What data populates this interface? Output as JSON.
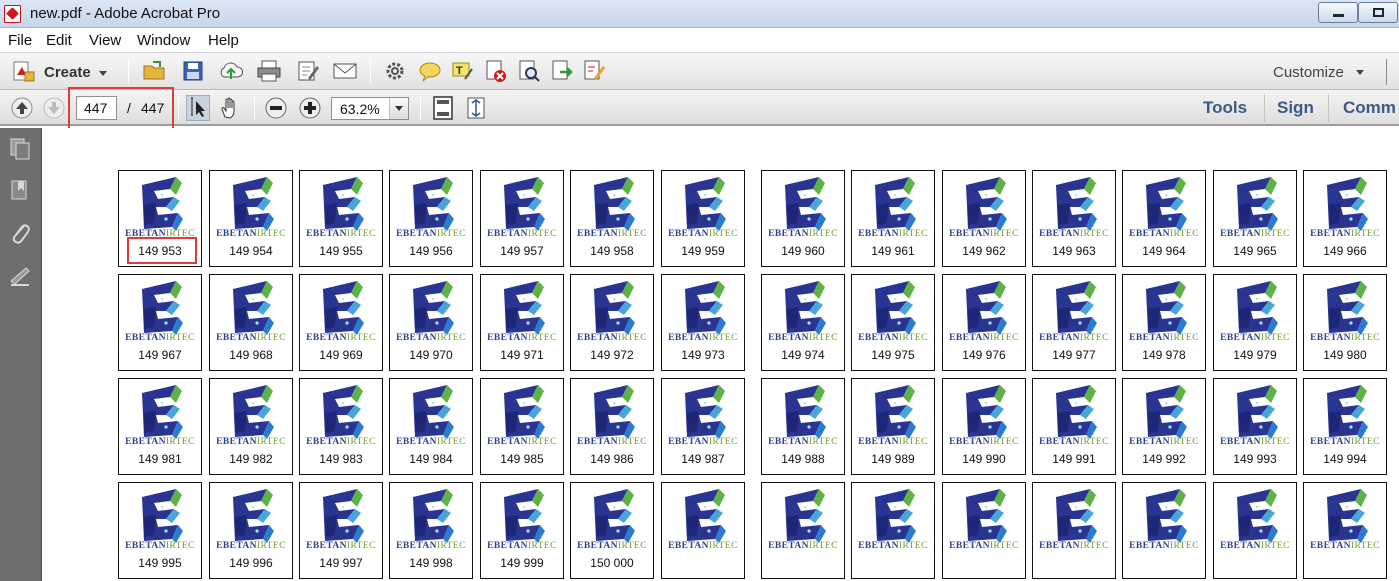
{
  "window": {
    "title": "new.pdf - Adobe Acrobat Pro"
  },
  "menu": [
    "File",
    "Edit",
    "View",
    "Window",
    "Help"
  ],
  "toolbar": {
    "create_label": "Create",
    "customize_label": "Customize"
  },
  "navigation": {
    "current_page": "447",
    "separator": "/",
    "total_pages": "447"
  },
  "zoom": {
    "value": "63.2%"
  },
  "right_links": {
    "tools": "Tools",
    "sign": "Sign",
    "comment": "Comm"
  },
  "thumbnail_brand": {
    "part1": "EBETAN",
    "part2": "IRTEC"
  },
  "thumbnails": [
    "149 953",
    "149 954",
    "149 955",
    "149 956",
    "149 957",
    "149 958",
    "149 959",
    "149 960",
    "149 961",
    "149 962",
    "149 963",
    "149 964",
    "149 965",
    "149 966",
    "149 967",
    "149 968",
    "149 969",
    "149 970",
    "149 971",
    "149 972",
    "149 973",
    "149 974",
    "149 975",
    "149 976",
    "149 977",
    "149 978",
    "149 979",
    "149 980",
    "149 981",
    "149 982",
    "149 983",
    "149 984",
    "149 985",
    "149 986",
    "149 987",
    "149 988",
    "149 989",
    "149 990",
    "149 991",
    "149 992",
    "149 993",
    "149 994",
    "149 995",
    "149 996",
    "149 997",
    "149 998",
    "149 999",
    "150 000",
    "",
    "",
    "",
    "",
    "",
    "",
    "",
    ""
  ],
  "colors": {
    "highlight": "#e23a3a",
    "nav_pane": "#6e6e6e",
    "link": "#3d5a86",
    "brand_blue": "#2d3f8f",
    "brand_green": "#6c9d2f"
  }
}
